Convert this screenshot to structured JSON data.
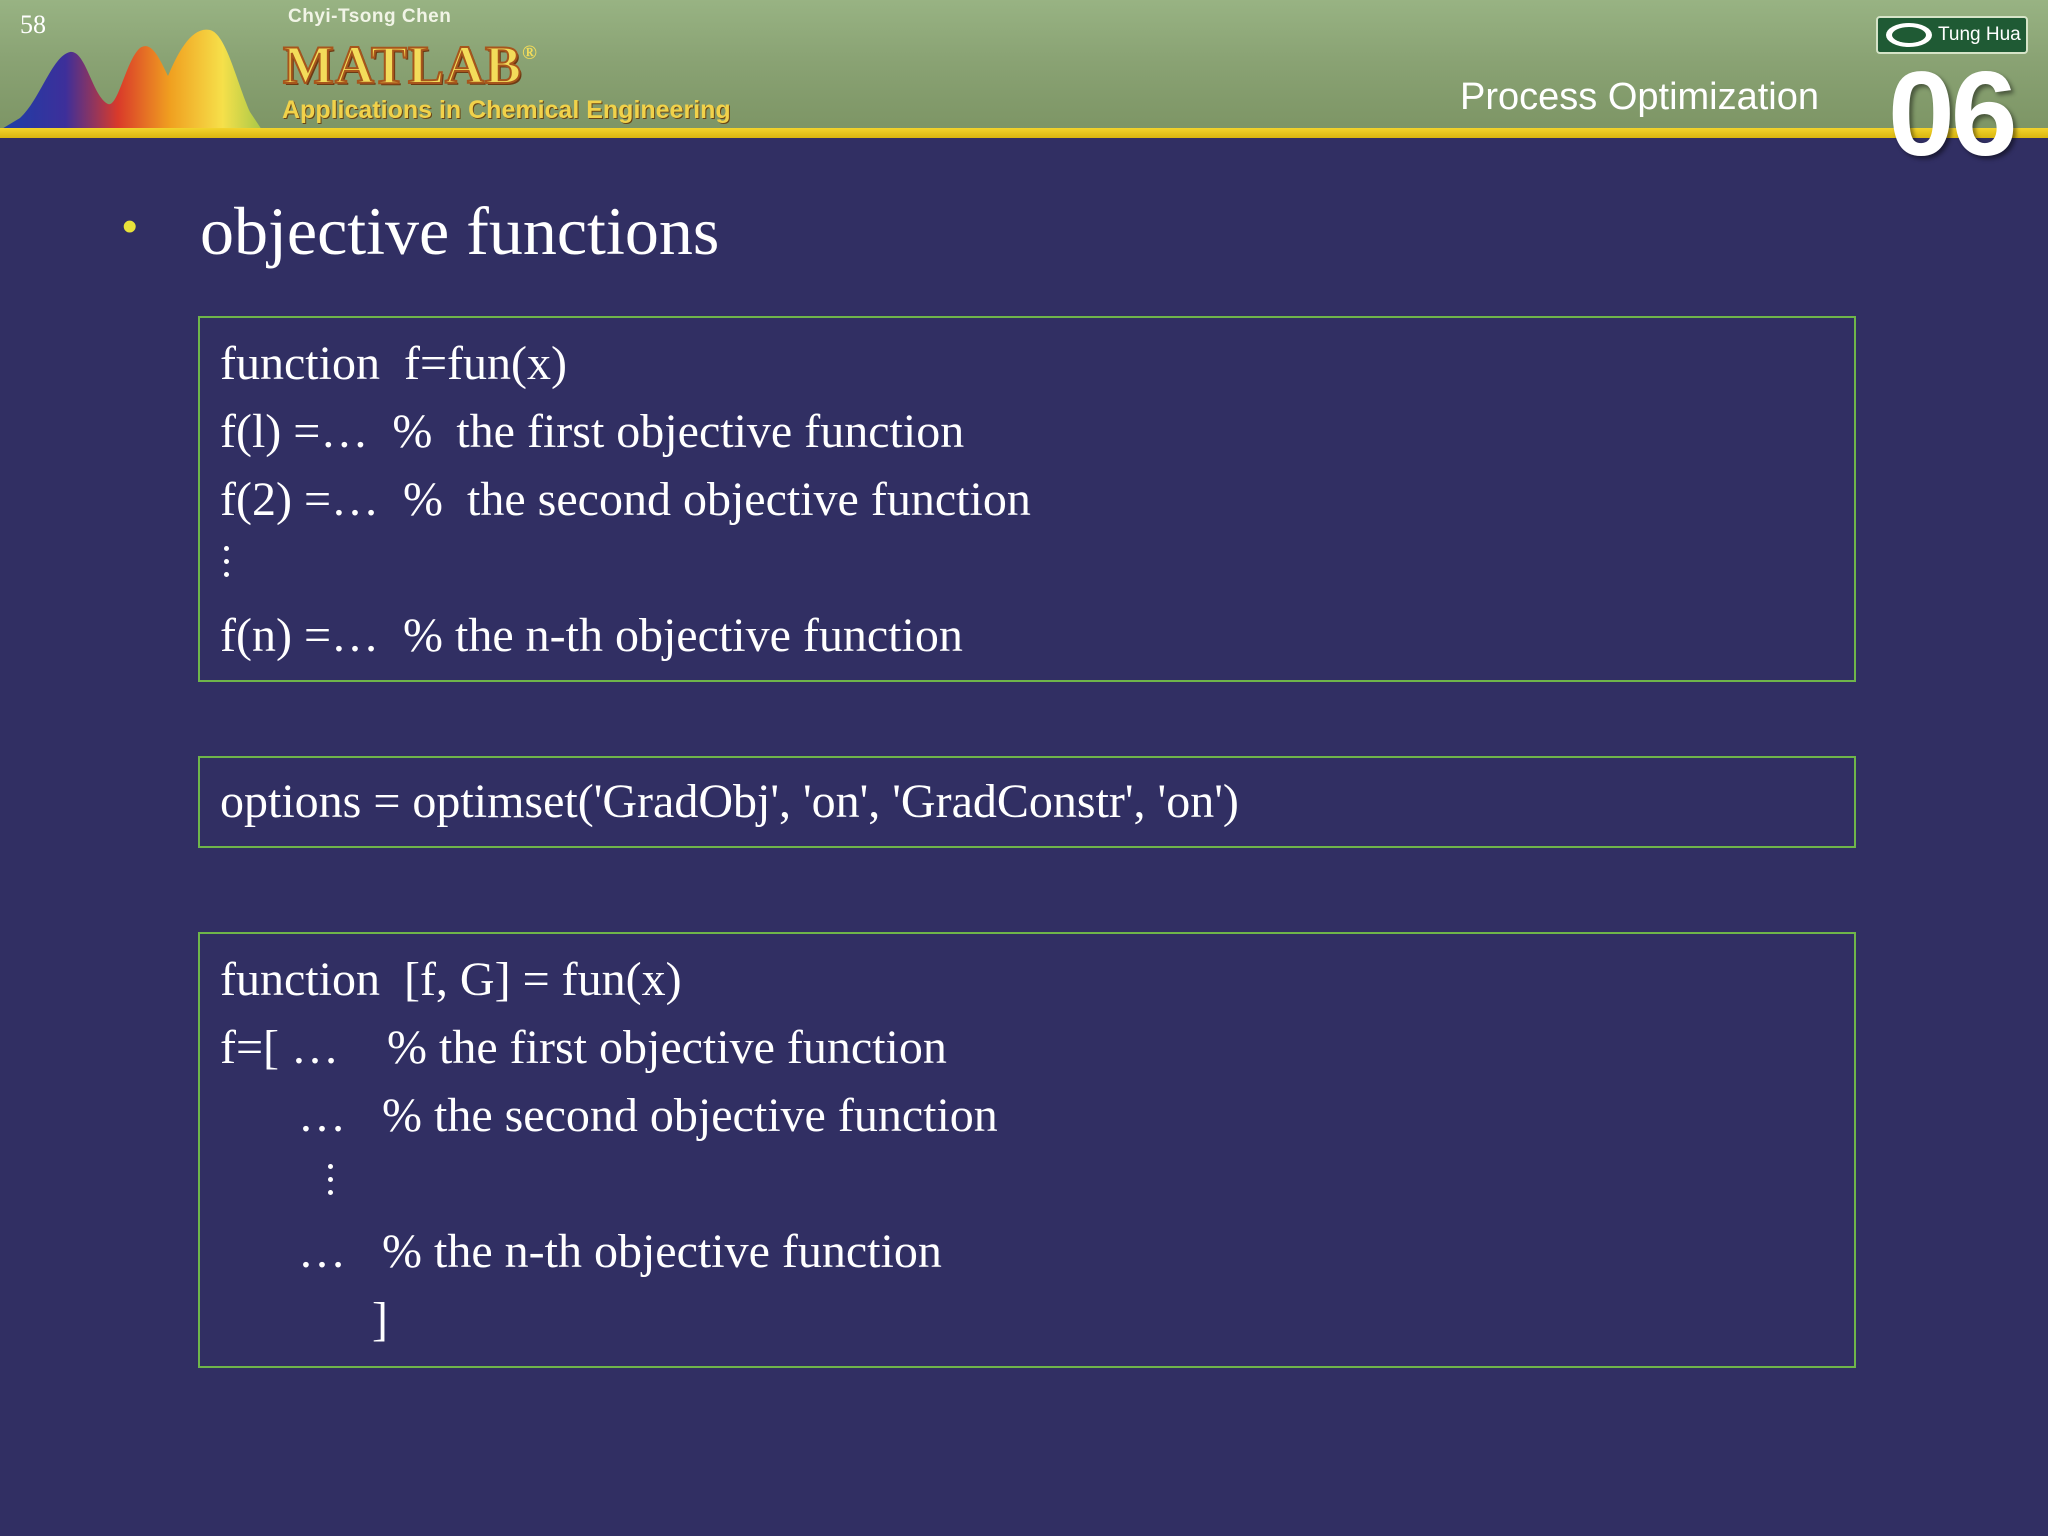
{
  "header": {
    "slide_number": "58",
    "author": "Chyi-Tsong Chen",
    "logo": "MATLAB",
    "logo_mark": "®",
    "subtitle": "Applications in Chemical Engineering",
    "chapter_title": "Process Optimization",
    "chapter_number": "06",
    "publisher": "Tung Hua"
  },
  "slide": {
    "bullet_heading": "objective functions",
    "box1": {
      "lines": [
        "function  f=fun(x)",
        "f(l) =…  %  the first objective function",
        "f(2) =…  %  the second objective function",
        "f(n) =…  % the n-th objective function"
      ]
    },
    "box2": {
      "line": "options = optimset('GradObj', 'on', 'GradConstr', 'on')"
    },
    "box3": {
      "lines": [
        "function  [f, G] = fun(x)",
        "f=[ …    % the first objective function",
        "…   % the second objective function",
        "…   % the n-th objective function",
        "]"
      ]
    }
  },
  "colors": {
    "background": "#312f63",
    "header_green": "#8aa374",
    "rule_yellow": "#e6c420",
    "box_border": "#6fb54a",
    "bullet": "#e8e23a"
  }
}
